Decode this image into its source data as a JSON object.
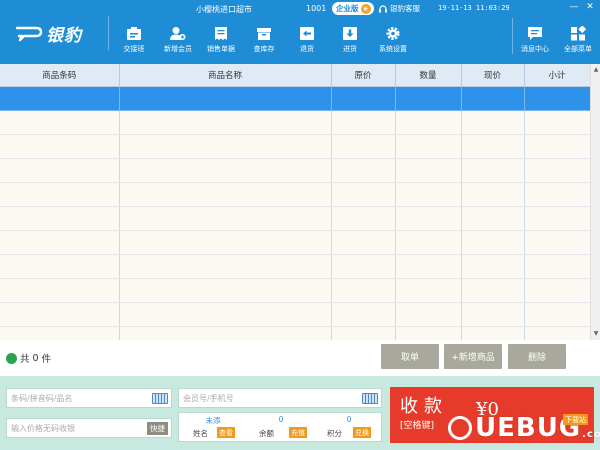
{
  "app": {
    "logo_text": "银豹",
    "title": "小樱桃进口超市",
    "shop_id": "1001",
    "edition": "企业版",
    "service": "银豹客服",
    "datetime": "19-11-13 11:03:29",
    "window_controls": [
      "—",
      "✕"
    ]
  },
  "toolbar": [
    {
      "label": "交接班",
      "icon": "handover-icon"
    },
    {
      "label": "新增会员",
      "icon": "add-member-icon"
    },
    {
      "label": "销售单据",
      "icon": "sales-receipt-icon"
    },
    {
      "label": "查库存",
      "icon": "inventory-icon"
    },
    {
      "label": "退货",
      "icon": "return-icon"
    },
    {
      "label": "进货",
      "icon": "purchase-icon"
    },
    {
      "label": "系统设置",
      "icon": "gear-icon"
    },
    {
      "label": "消息中心",
      "icon": "message-icon"
    },
    {
      "label": "全部菜单",
      "icon": "menu-grid-icon"
    }
  ],
  "table": {
    "columns": [
      "商品条码",
      "商品名称",
      "原价",
      "数量",
      "现价",
      "小计"
    ],
    "selected_row": 0,
    "row_count": 11
  },
  "actions": {
    "count_prefix": "共",
    "count_value": "0",
    "count_suffix": "件",
    "buttons": [
      "取单",
      "+新增商品",
      "删除"
    ]
  },
  "inputs": {
    "barcode_placeholder": "条码/拼音码/品名",
    "member_placeholder": "会员号/手机号",
    "price_placeholder": "输入价格无码收银",
    "quick_label": "快捷"
  },
  "member": {
    "name_value": "未添",
    "name_label": "姓名",
    "name_tag": "查看",
    "balance_value": "0",
    "balance_label": "余额",
    "balance_tag": "充值",
    "points_value": "0",
    "points_label": "积分",
    "points_tag": "兑换"
  },
  "checkout": {
    "title": "收款",
    "hotkey": "[空格键]",
    "amount": "¥0"
  },
  "watermark": {
    "text": "UEBUG",
    "suffix": ".com",
    "badge": "下载站"
  }
}
